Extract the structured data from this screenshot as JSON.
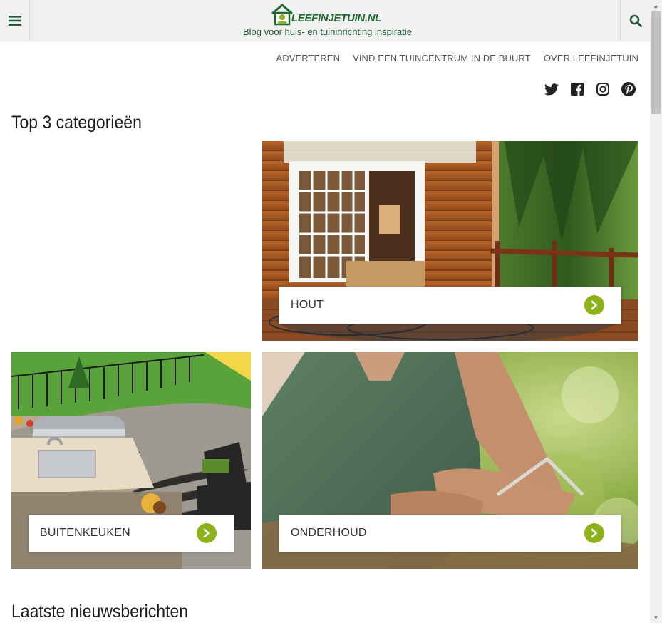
{
  "header": {
    "logo_text": "LEEFINJETUIN.NL",
    "tagline": "Blog voor huis- en tuininrichting inspiratie",
    "menu_icon": "hamburger-menu-icon",
    "search_icon": "search-icon"
  },
  "topnav": {
    "items": [
      "ADVERTEREN",
      "VIND EEN TUINCENTRUM IN DE BUURT",
      "OVER LEEFINJETUIN"
    ]
  },
  "social": {
    "icons": [
      "twitter-icon",
      "facebook-icon",
      "instagram-icon",
      "pinterest-icon"
    ]
  },
  "categories": {
    "heading": "Top 3 categorieën",
    "items": [
      {
        "label": "HOUT"
      },
      {
        "label": "BUITENKEUKEN"
      },
      {
        "label": "ONDERHOUD"
      }
    ]
  },
  "news": {
    "heading": "Laatste nieuwsberichten"
  },
  "colors": {
    "brand_green": "#1f6a2e",
    "accent_green": "#8cb31c",
    "header_bg": "#f1f1f1"
  }
}
